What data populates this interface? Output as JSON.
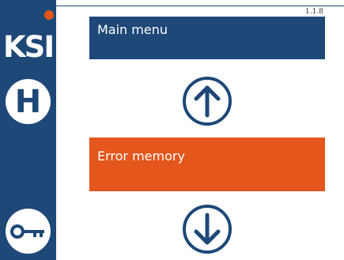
{
  "app": {
    "logo_text": "KSI",
    "version": "1.1.8"
  },
  "sidebar": {
    "home_label": "H"
  },
  "menu": {
    "main_label": "Main menu",
    "error_label": "Error memory"
  },
  "icons": {
    "status": "status-dot-icon",
    "home": "home-icon",
    "key": "key-icon",
    "up": "arrow-up-icon",
    "down": "arrow-down-icon"
  },
  "colors": {
    "brand_blue": "#1d4877",
    "accent_orange": "#e4561b",
    "background": "#ffffff"
  }
}
